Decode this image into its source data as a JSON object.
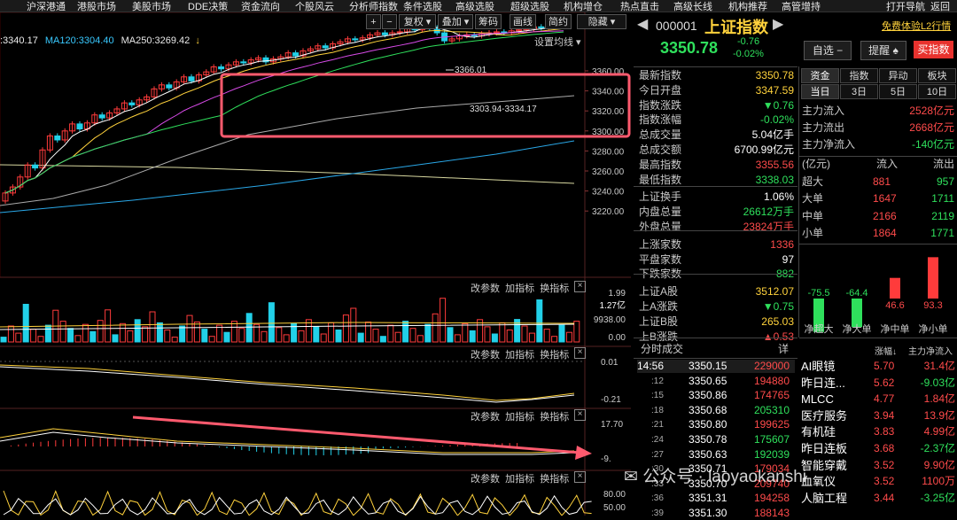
{
  "topmenu": [
    "沪深港通",
    "港股市场",
    "美股市场",
    "DDE决策",
    "资金流向",
    "个股风云",
    "分析师指数",
    "条件选股",
    "高级选股",
    "超级选股",
    "机构增仓",
    "热点直击",
    "高级长线",
    "机构推荐",
    "高管增持",
    "打开导航",
    "返回"
  ],
  "toolbar": {
    "plus": "+",
    "minus": "−",
    "fuquan": "复权",
    "diejia": "叠加",
    "chouma": "筹码",
    "huaxian": "画线",
    "jianyue": "简约",
    "yincang": "隐藏"
  },
  "ma": {
    "prefix": ":3340.17",
    "ma120": "MA120:3304.40",
    "ma250": "MA250:3269.42",
    "arrow": "↓"
  },
  "settings_label": "设置均线",
  "price_ticks": [
    "3360.00",
    "3340.00",
    "3320.00",
    "3300.00",
    "3280.00",
    "3260.00",
    "3240.00",
    "3220.00"
  ],
  "annotations": {
    "high": "3366.01",
    "range": "3303.94-3334.17"
  },
  "panel_buttons": {
    "param": "改参数",
    "add": "加指标",
    "switch": "换指标",
    "close": "×"
  },
  "vol_ticks": [
    "1.99",
    "1.27亿",
    "9938.00",
    "0.00"
  ],
  "p2_ticks": [
    "0.01",
    "-0.21"
  ],
  "p3_ticks": [
    "17.70",
    "-9."
  ],
  "p4_ticks": [
    "80.00",
    "50.00"
  ],
  "index": {
    "code": "000001",
    "name": "上证指数",
    "price": "3350.78",
    "change": "-0.76",
    "pct": "-0.02%",
    "promo": "免费体验L2行情"
  },
  "index_buttons": {
    "zixuan": "自选 −",
    "tixing": "提醒",
    "buy": "买指数"
  },
  "stats": [
    {
      "label": "最新指数",
      "value": "3350.78",
      "color": "yel"
    },
    {
      "label": "今日开盘",
      "value": "3347.59",
      "color": "yel"
    },
    {
      "label": "指数涨跌",
      "value": "▼0.76",
      "color": "grn"
    },
    {
      "label": "指数涨幅",
      "value": "-0.02%",
      "color": "grn"
    },
    {
      "label": "总成交量",
      "value": "5.04亿手",
      "color": "wht"
    },
    {
      "label": "总成交额",
      "value": "6700.99亿元",
      "color": "wht"
    },
    {
      "label": "最高指数",
      "value": "3355.56",
      "color": "red"
    },
    {
      "label": "最低指数",
      "value": "3338.03",
      "color": "grn"
    },
    {
      "label": "上证换手",
      "value": "1.06%",
      "color": "wht"
    },
    {
      "label": "内盘总量",
      "value": "26612万手",
      "color": "grn"
    },
    {
      "label": "外盘总量",
      "value": "23824万手",
      "color": "red"
    },
    {
      "label": "上涨家数",
      "value": "1336",
      "color": "red"
    },
    {
      "label": "平盘家数",
      "value": "97",
      "color": "wht"
    },
    {
      "label": "下跌家数",
      "value": "882",
      "color": "grn"
    },
    {
      "label": "上证A股",
      "value": "3512.07",
      "color": "yel"
    },
    {
      "label": "上A涨跌",
      "value": "▼0.75",
      "color": "grn"
    },
    {
      "label": "上证B股",
      "value": "265.03",
      "color": "yel"
    },
    {
      "label": "上B涨跌",
      "value": "▲0.53",
      "color": "red"
    }
  ],
  "fund_tabs": [
    "资金",
    "指数",
    "异动",
    "板块"
  ],
  "period_tabs": [
    "当日",
    "3日",
    "5日",
    "10日"
  ],
  "flows": [
    {
      "label": "主力流入",
      "value": "2528亿元",
      "color": "red"
    },
    {
      "label": "主力流出",
      "value": "2668亿元",
      "color": "red"
    },
    {
      "label": "主力净流入",
      "value": "-140亿元",
      "color": "grn"
    }
  ],
  "flow_table": {
    "unit": "(亿元)",
    "in": "流入",
    "out": "流出",
    "rows": [
      {
        "label": "超大",
        "in": "881",
        "out": "957"
      },
      {
        "label": "大单",
        "in": "1647",
        "out": "1711"
      },
      {
        "label": "中单",
        "in": "2166",
        "out": "2119"
      },
      {
        "label": "小单",
        "in": "1864",
        "out": "1771"
      }
    ]
  },
  "net_bars": [
    {
      "label": "净超大",
      "value": -75.5,
      "text": "-75.5"
    },
    {
      "label": "净大单",
      "value": -64.4,
      "text": "-64.4"
    },
    {
      "label": "净中单",
      "value": 46.6,
      "text": "46.6"
    },
    {
      "label": "净小单",
      "value": 93.3,
      "text": "93.3"
    }
  ],
  "trades_title": "分时成交",
  "trades_detail": "详",
  "trades": [
    {
      "time": "14:56",
      "price": "3350.15",
      "vol": "229000",
      "color": "red"
    },
    {
      "time": ":12",
      "price": "3350.65",
      "vol": "194880",
      "color": "red"
    },
    {
      "time": ":15",
      "price": "3350.86",
      "vol": "174765",
      "color": "red"
    },
    {
      "time": ":18",
      "price": "3350.68",
      "vol": "205310",
      "color": "grn"
    },
    {
      "time": ":21",
      "price": "3350.80",
      "vol": "199625",
      "color": "red"
    },
    {
      "time": ":24",
      "price": "3350.78",
      "vol": "175607",
      "color": "grn"
    },
    {
      "time": ":27",
      "price": "3350.63",
      "vol": "192039",
      "color": "grn"
    },
    {
      "time": ":30",
      "price": "3350.71",
      "vol": "179034",
      "color": "red"
    },
    {
      "time": ":33",
      "price": "3350.70",
      "vol": "209740",
      "color": "red"
    },
    {
      "time": ":36",
      "price": "3351.31",
      "vol": "194258",
      "color": "red"
    },
    {
      "time": ":39",
      "price": "3351.30",
      "vol": "188143",
      "color": "red"
    }
  ],
  "sectors_header": {
    "pct": "涨幅↓",
    "flow": "主力净流入"
  },
  "sectors": [
    {
      "name": "AI眼镜",
      "pct": "5.70",
      "flow": "31.4亿",
      "fcolor": "red"
    },
    {
      "name": "昨日连...",
      "pct": "5.62",
      "flow": "-9.03亿",
      "fcolor": "grn"
    },
    {
      "name": "MLCC",
      "pct": "4.77",
      "flow": "1.84亿",
      "fcolor": "red"
    },
    {
      "name": "医疗服务",
      "pct": "3.94",
      "flow": "13.9亿",
      "fcolor": "red"
    },
    {
      "name": "有机硅",
      "pct": "3.83",
      "flow": "4.99亿",
      "fcolor": "red"
    },
    {
      "name": "昨日连板",
      "pct": "3.68",
      "flow": "-2.37亿",
      "fcolor": "grn"
    },
    {
      "name": "智能穿戴",
      "pct": "3.52",
      "flow": "9.90亿",
      "fcolor": "red"
    },
    {
      "name": "血氧仪",
      "pct": "3.52",
      "flow": "1100万",
      "fcolor": "red"
    },
    {
      "name": "人脑工程",
      "pct": "3.44",
      "flow": "-3.25亿",
      "fcolor": "grn"
    }
  ],
  "watermark": "公众号 · laoyaokanshi",
  "colors": {
    "up": "#ff3b3b",
    "down": "#22d0e8",
    "green": "#2fe05c",
    "yellow": "#ffd23c",
    "highlight": "#ff5a6e"
  }
}
